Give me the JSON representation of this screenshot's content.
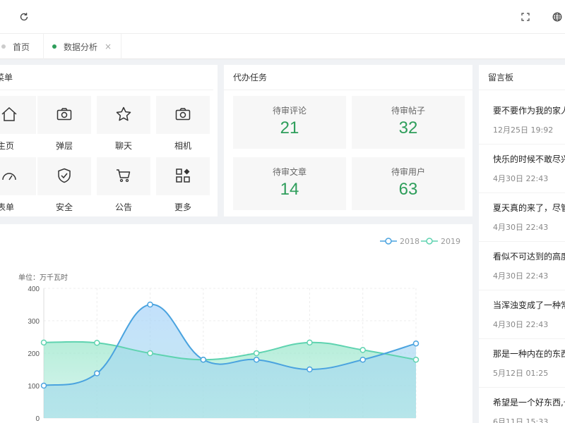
{
  "tabs": [
    {
      "label": "首页",
      "active": false
    },
    {
      "label": "数据分析",
      "active": true,
      "close": "×"
    }
  ],
  "menu": {
    "title": "菜单",
    "items": [
      {
        "label": "主页",
        "icon": "home-icon"
      },
      {
        "label": "弹层",
        "icon": "camera-icon"
      },
      {
        "label": "聊天",
        "icon": "star-icon"
      },
      {
        "label": "相机",
        "icon": "camera-icon"
      },
      {
        "label": "表单",
        "icon": "gauge-icon"
      },
      {
        "label": "安全",
        "icon": "shield-check-icon"
      },
      {
        "label": "公告",
        "icon": "cart-icon"
      },
      {
        "label": "更多",
        "icon": "apps-icon"
      }
    ]
  },
  "tasks": {
    "title": "代办任务",
    "items": [
      {
        "label": "待审评论",
        "value": "21"
      },
      {
        "label": "待审帖子",
        "value": "32"
      },
      {
        "label": "待审文章",
        "value": "14"
      },
      {
        "label": "待审用户",
        "value": "63"
      }
    ]
  },
  "messages": {
    "title": "留言板",
    "items": [
      {
        "text": "要不要作为我的家人",
        "date": "12月25日 19:92"
      },
      {
        "text": "快乐的时候不敢尽兴",
        "date": "4月30日 22:43"
      },
      {
        "text": "夏天真的来了，尽管",
        "date": "4月30日 22:43"
      },
      {
        "text": "看似不可达到的高度",
        "date": "4月30日 22:43"
      },
      {
        "text": "当浑浊变成了一种常",
        "date": "4月30日 22:43"
      },
      {
        "text": "那是一种内在的东西",
        "date": "5月12日 01:25"
      },
      {
        "text": "希望是一个好东西,也",
        "date": "6月11日 15:33"
      }
    ]
  },
  "chart_data": {
    "type": "area",
    "ylabel": "单位：万千瓦时",
    "ylim": [
      0,
      400
    ],
    "yticks": [
      "0",
      "100",
      "200",
      "300",
      "400"
    ],
    "x": [
      0,
      1,
      2,
      3,
      4,
      5,
      6,
      7
    ],
    "series": [
      {
        "name": "2018",
        "values": [
          100,
          138,
          350,
          180,
          180,
          150,
          180,
          230
        ],
        "color": "#4aa3df"
      },
      {
        "name": "2019",
        "values": [
          233,
          232,
          200,
          180,
          200,
          233,
          210,
          180
        ],
        "color": "#5fd3b0"
      }
    ],
    "grid": true,
    "legend": "top-right"
  },
  "colors": {
    "accent": "#2e9e5b",
    "tab_dot_active": "#2e9e5b",
    "tab_dot_inactive": "#cccccc"
  }
}
